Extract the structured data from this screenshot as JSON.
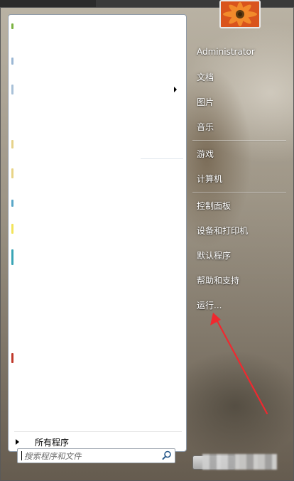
{
  "start_menu": {
    "all_programs": "所有程序",
    "search": {
      "placeholder": "搜索程序和文件"
    },
    "right_items": [
      "Administrator",
      "文档",
      "图片",
      "音乐",
      "游戏",
      "计算机",
      "控制面板",
      "设备和打印机",
      "默认程序",
      "帮助和支持",
      "运行..."
    ]
  },
  "colors": {
    "annotation_arrow": "#f0282f",
    "avatar_flower": "#e25a1c"
  }
}
